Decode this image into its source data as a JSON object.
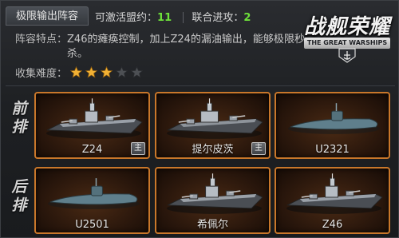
{
  "header": {
    "title": "极限输出阵容",
    "activatable_label": "可激活盟约：",
    "activatable_value": "11",
    "combo_label": "联合进攻：",
    "combo_value": "2"
  },
  "logo": {
    "title": "战舰荣耀",
    "subtitle": "THE GREAT WARSHIPS"
  },
  "info": {
    "features_label": "阵容特点：",
    "features_text": "Z46的瘫痪控制，加上Z24的漏油输出，能够极限秒杀。",
    "difficulty_label": "收集难度：",
    "difficulty_rating": 3,
    "difficulty_max": 5
  },
  "rows": {
    "front_label": "前排",
    "back_label": "后排"
  },
  "ships": [
    {
      "name": "Z24",
      "badge": "主",
      "kind": "destroyer"
    },
    {
      "name": "提尔皮茨",
      "badge": "主",
      "kind": "battleship"
    },
    {
      "name": "U2321",
      "badge": "",
      "kind": "submarine"
    },
    {
      "name": "U2501",
      "badge": "",
      "kind": "submarine"
    },
    {
      "name": "希佩尔",
      "badge": "",
      "kind": "cruiser"
    },
    {
      "name": "Z46",
      "badge": "",
      "kind": "destroyer"
    }
  ],
  "colors": {
    "accent_green": "#6ee23a",
    "card_border": "#c9772a",
    "star_on": "#f2b134",
    "star_off": "#4d5054"
  }
}
